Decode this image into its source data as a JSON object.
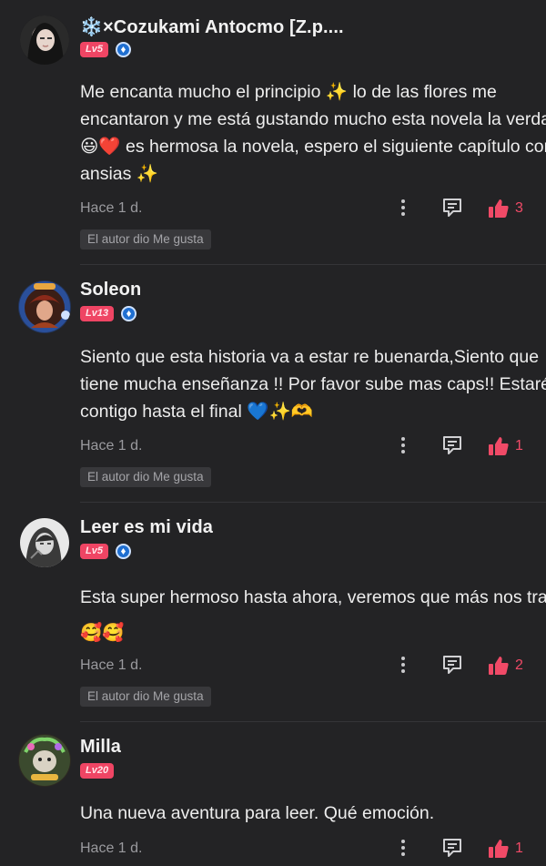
{
  "comments": [
    {
      "name": "❄️×Cozukami Antocmo [Z.p....",
      "level": "Lv5",
      "text": "Me encanta mucho el principio ✨ lo de las flores me encantaron y me está gustando mucho esta novela la verdad 😃❤️ es hermosa la novela, espero el siguiente capítulo con ansias ✨",
      "time": "Hace 1 d.",
      "likes": "3",
      "author_like": "El autor dio Me gusta"
    },
    {
      "name": "Soleon",
      "level": "Lv13",
      "text": "Siento que esta historia va a estar re buenarda,Siento que tiene mucha enseñanza !! Por favor sube mas caps!! Estaré contigo hasta el final 💙✨🫶",
      "time": "Hace 1 d.",
      "likes": "1",
      "author_like": "El autor dio Me gusta"
    },
    {
      "name": "Leer es mi vida",
      "level": "Lv5",
      "text": "Esta super hermoso hasta ahora, veremos que más nos traes🥰🥰",
      "time": "Hace 1 d.",
      "likes": "2",
      "author_like": "El autor dio Me gusta"
    },
    {
      "name": "Milla",
      "level": "Lv20",
      "text": "Una nueva aventura para leer. Qué emoción.",
      "time": "Hace 1 d.",
      "likes": "1"
    }
  ],
  "colors": {
    "accent": "#f04a67",
    "background": "#232325",
    "level_badge": "#ef4564"
  }
}
